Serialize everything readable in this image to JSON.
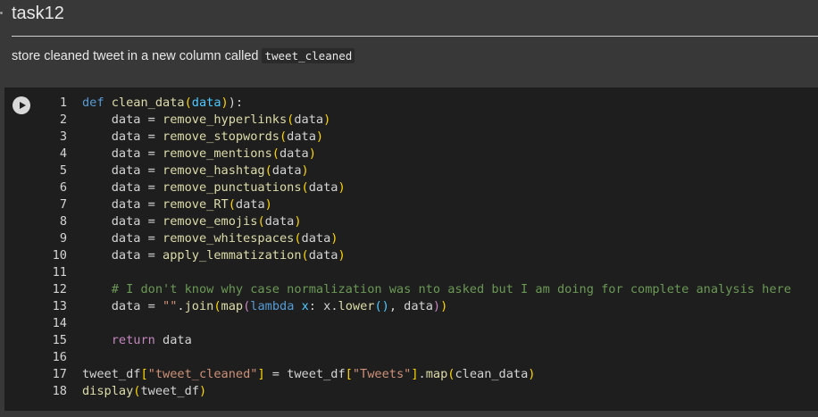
{
  "markdown": {
    "heading": "task12",
    "text_prefix": "store cleaned tweet in a new column called",
    "inline_code": "tweet_cleaned"
  },
  "code_cell": {
    "run_button_label": "Run cell",
    "lines": [
      {
        "n": "1",
        "tokens": [
          [
            "kw",
            "def "
          ],
          [
            "fn",
            "clean_data"
          ],
          [
            "br",
            "("
          ],
          [
            "par",
            "data"
          ],
          [
            "br",
            ")"
          ],
          [
            "",
            "):"
          ]
        ]
      },
      {
        "n": "2",
        "tokens": [
          [
            "",
            "    data = "
          ],
          [
            "fn",
            "remove_hyperlinks"
          ],
          [
            "br",
            "("
          ],
          [
            "",
            "data"
          ],
          [
            "br",
            ")"
          ]
        ]
      },
      {
        "n": "3",
        "tokens": [
          [
            "",
            "    data = "
          ],
          [
            "fn",
            "remove_stopwords"
          ],
          [
            "br",
            "("
          ],
          [
            "",
            "data"
          ],
          [
            "br",
            ")"
          ]
        ]
      },
      {
        "n": "4",
        "tokens": [
          [
            "",
            "    data = "
          ],
          [
            "fn",
            "remove_mentions"
          ],
          [
            "br",
            "("
          ],
          [
            "",
            "data"
          ],
          [
            "br",
            ")"
          ]
        ]
      },
      {
        "n": "5",
        "tokens": [
          [
            "",
            "    data = "
          ],
          [
            "fn",
            "remove_hashtag"
          ],
          [
            "br",
            "("
          ],
          [
            "",
            "data"
          ],
          [
            "br",
            ")"
          ]
        ]
      },
      {
        "n": "6",
        "tokens": [
          [
            "",
            "    data = "
          ],
          [
            "fn",
            "remove_punctuations"
          ],
          [
            "br",
            "("
          ],
          [
            "",
            "data"
          ],
          [
            "br",
            ")"
          ]
        ]
      },
      {
        "n": "7",
        "tokens": [
          [
            "",
            "    data = "
          ],
          [
            "fn",
            "remove_RT"
          ],
          [
            "br",
            "("
          ],
          [
            "",
            "data"
          ],
          [
            "br",
            ")"
          ]
        ]
      },
      {
        "n": "8",
        "tokens": [
          [
            "",
            "    data = "
          ],
          [
            "fn",
            "remove_emojis"
          ],
          [
            "br",
            "("
          ],
          [
            "",
            "data"
          ],
          [
            "br",
            ")"
          ]
        ]
      },
      {
        "n": "9",
        "tokens": [
          [
            "",
            "    data = "
          ],
          [
            "fn",
            "remove_whitespaces"
          ],
          [
            "br",
            "("
          ],
          [
            "",
            "data"
          ],
          [
            "br",
            ")"
          ]
        ]
      },
      {
        "n": "10",
        "tokens": [
          [
            "",
            "    data = "
          ],
          [
            "fn",
            "apply_lemmatization"
          ],
          [
            "br",
            "("
          ],
          [
            "",
            "data"
          ],
          [
            "br",
            ")"
          ]
        ]
      },
      {
        "n": "11",
        "tokens": []
      },
      {
        "n": "12",
        "tokens": [
          [
            "",
            "    "
          ],
          [
            "cm",
            "# I don't know why case normalization was nto asked but I am doing for complete analysis here"
          ]
        ]
      },
      {
        "n": "13",
        "tokens": [
          [
            "",
            "    data = "
          ],
          [
            "str",
            "\"\""
          ],
          [
            "",
            "."
          ],
          [
            "fn",
            "join"
          ],
          [
            "br",
            "("
          ],
          [
            "fn",
            "map"
          ],
          [
            "cf",
            "("
          ],
          [
            "kw",
            "lambda"
          ],
          [
            "par",
            " x"
          ],
          [
            "",
            ": x."
          ],
          [
            "fn",
            "lower"
          ],
          [
            "par",
            "()"
          ],
          [
            "",
            ", data"
          ],
          [
            "cf",
            ")"
          ],
          [
            "br",
            ")"
          ]
        ]
      },
      {
        "n": "14",
        "tokens": []
      },
      {
        "n": "15",
        "tokens": [
          [
            "",
            "    "
          ],
          [
            "cf",
            "return"
          ],
          [
            "",
            " data"
          ]
        ]
      },
      {
        "n": "16",
        "tokens": []
      },
      {
        "n": "17",
        "tokens": [
          [
            "",
            "tweet_df"
          ],
          [
            "br",
            "["
          ],
          [
            "str",
            "\"tweet_cleaned\""
          ],
          [
            "br",
            "]"
          ],
          [
            "",
            " = tweet_df"
          ],
          [
            "br",
            "["
          ],
          [
            "str",
            "\"Tweets\""
          ],
          [
            "br",
            "]"
          ],
          [
            "",
            "."
          ],
          [
            "fn",
            "map"
          ],
          [
            "br",
            "("
          ],
          [
            "",
            "clean_data"
          ],
          [
            "br",
            ")"
          ]
        ]
      },
      {
        "n": "18",
        "tokens": [
          [
            "fn",
            "display"
          ],
          [
            "br",
            "("
          ],
          [
            "",
            "tweet_df"
          ],
          [
            "br",
            ")"
          ]
        ]
      }
    ]
  }
}
